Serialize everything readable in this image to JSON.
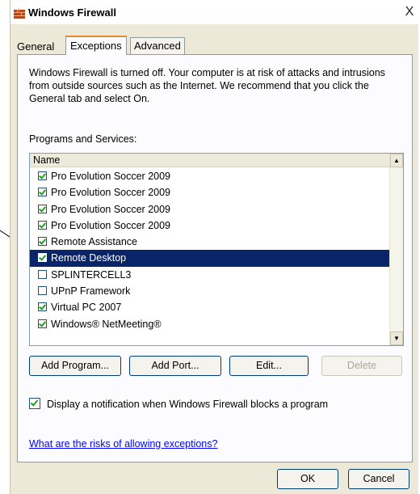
{
  "window": {
    "title": "Windows Firewall",
    "close_label": "X"
  },
  "tabs": [
    {
      "label": "General"
    },
    {
      "label": "Exceptions"
    },
    {
      "label": "Advanced"
    }
  ],
  "info_text": "Windows Firewall is turned off. Your computer is at risk of attacks and intrusions from outside sources such as the Internet. We recommend that you click the General tab and select On.",
  "programs": {
    "group_label": "Programs and Services:",
    "column_header": "Name",
    "items": [
      {
        "label": "Pro Evolution Soccer 2009",
        "checked": true
      },
      {
        "label": "Pro Evolution Soccer 2009",
        "checked": true
      },
      {
        "label": "Pro Evolution Soccer 2009",
        "checked": true
      },
      {
        "label": "Pro Evolution Soccer 2009",
        "checked": true
      },
      {
        "label": "Remote Assistance",
        "checked": true
      },
      {
        "label": "Remote Desktop",
        "checked": true,
        "selected": true
      },
      {
        "label": "SPLINTERCELL3",
        "checked": false
      },
      {
        "label": "UPnP Framework",
        "checked": false
      },
      {
        "label": "Virtual PC 2007",
        "checked": true
      },
      {
        "label": "Windows® NetMeeting®",
        "checked": true
      }
    ]
  },
  "buttons": {
    "add_program": "Add Program...",
    "add_port": "Add Port...",
    "edit": "Edit...",
    "delete": "Delete",
    "ok": "OK",
    "cancel": "Cancel"
  },
  "notify_label": "Display a notification when Windows Firewall blocks a program",
  "notify_checked": true,
  "risk_link": "What are the risks of allowing exceptions?",
  "colors": {
    "selection": "#0a246a",
    "link": "#0000ff",
    "dialog_bg": "#ece9d8"
  }
}
